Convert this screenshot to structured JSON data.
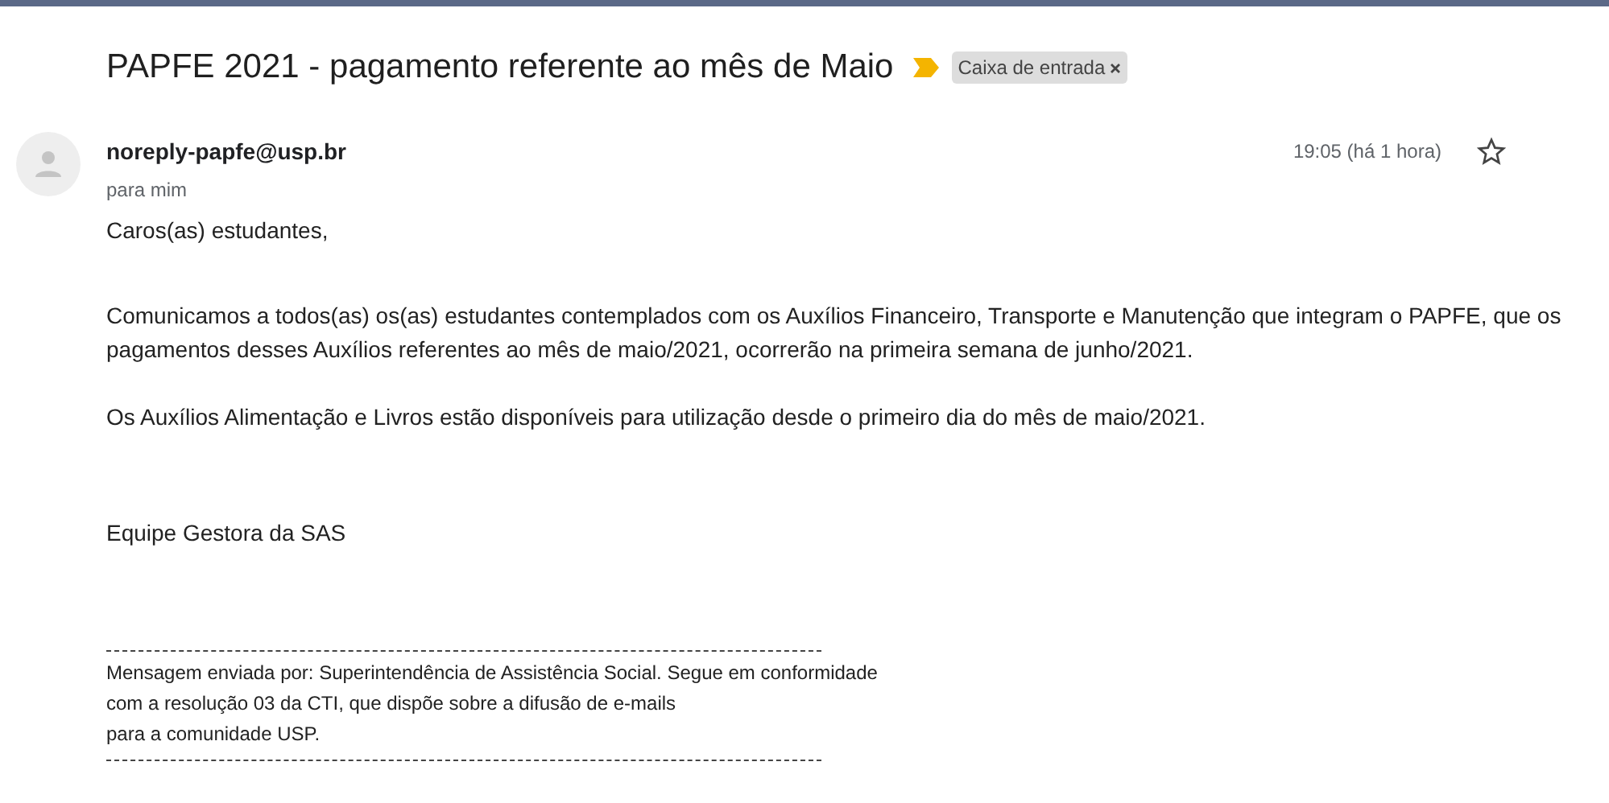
{
  "subject": "PAPFE 2021 - pagamento referente ao mês de Maio",
  "important": true,
  "labels": [
    {
      "text": "Caixa de entrada",
      "removable": true
    }
  ],
  "sender": {
    "address": "noreply-papfe@usp.br",
    "recipient": "para mim",
    "time": "19:05 (há 1 hora)",
    "starred": false
  },
  "body": [
    "Caros(as) estudantes,",
    "Comunicamos a todos(as) os(as) estudantes contemplados com os Auxílios Financeiro, Transporte e Manutenção que integram o PAPFE, que os pagamentos desses Auxílios referentes ao mês de maio/2021, ocorrerão na primeira semana de junho/2021.",
    "Os Auxílios Alimentação e Livros estão disponíveis para utilização desde o primeiro dia do mês de maio/2021.",
    "Equipe Gestora da SAS"
  ],
  "footer": [
    "Mensagem enviada por: Superintendência de Assistência Social. Segue em conformidade",
    "com a resolução 03 da CTI, que dispõe sobre a difusão de e-mails",
    "para a comunidade USP."
  ]
}
